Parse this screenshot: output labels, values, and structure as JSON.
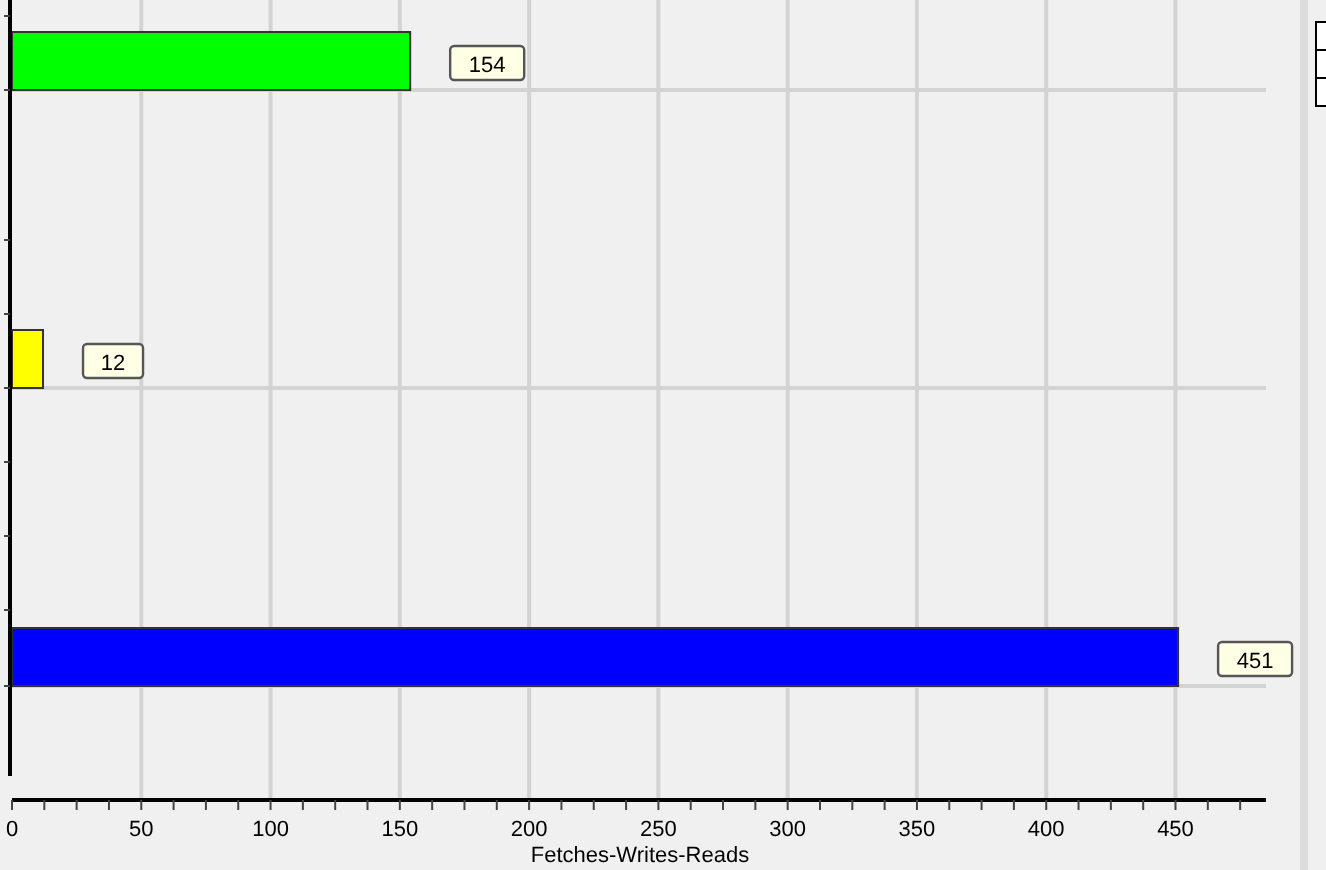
{
  "chart_data": {
    "type": "bar",
    "orientation": "horizontal",
    "xlabel": "Fetches-Writes-Reads",
    "values": [
      154,
      12,
      451
    ],
    "colors": [
      "#00ff00",
      "#ffff00",
      "#0000ff"
    ],
    "xlim": [
      0,
      485
    ],
    "xticks": [
      0,
      50,
      100,
      150,
      200,
      250,
      300,
      350,
      400,
      450
    ],
    "data_labels": true,
    "grid": true
  }
}
